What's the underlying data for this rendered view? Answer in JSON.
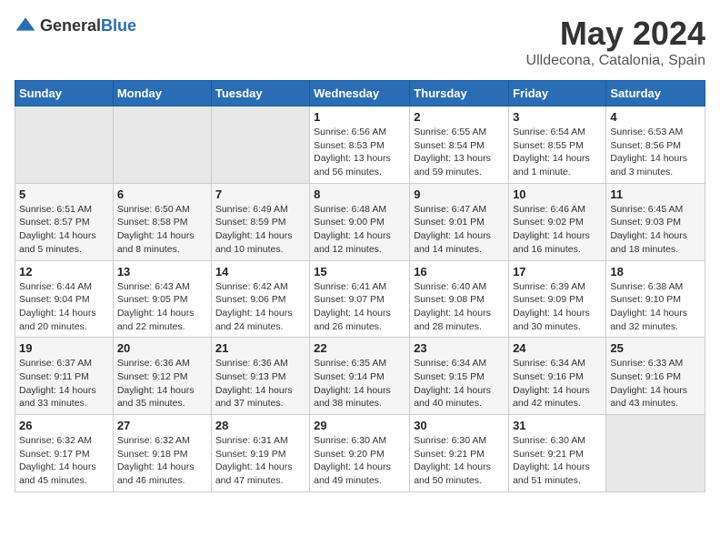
{
  "header": {
    "logo_general": "General",
    "logo_blue": "Blue",
    "month": "May 2024",
    "location": "Ulldecona, Catalonia, Spain"
  },
  "weekdays": [
    "Sunday",
    "Monday",
    "Tuesday",
    "Wednesday",
    "Thursday",
    "Friday",
    "Saturday"
  ],
  "weeks": [
    [
      {
        "day": "",
        "sunrise": "",
        "sunset": "",
        "daylight": "",
        "empty": true
      },
      {
        "day": "",
        "sunrise": "",
        "sunset": "",
        "daylight": "",
        "empty": true
      },
      {
        "day": "",
        "sunrise": "",
        "sunset": "",
        "daylight": "",
        "empty": true
      },
      {
        "day": "1",
        "sunrise": "Sunrise: 6:56 AM",
        "sunset": "Sunset: 8:53 PM",
        "daylight": "Daylight: 13 hours and 56 minutes."
      },
      {
        "day": "2",
        "sunrise": "Sunrise: 6:55 AM",
        "sunset": "Sunset: 8:54 PM",
        "daylight": "Daylight: 13 hours and 59 minutes."
      },
      {
        "day": "3",
        "sunrise": "Sunrise: 6:54 AM",
        "sunset": "Sunset: 8:55 PM",
        "daylight": "Daylight: 14 hours and 1 minute."
      },
      {
        "day": "4",
        "sunrise": "Sunrise: 6:53 AM",
        "sunset": "Sunset: 8:56 PM",
        "daylight": "Daylight: 14 hours and 3 minutes."
      }
    ],
    [
      {
        "day": "5",
        "sunrise": "Sunrise: 6:51 AM",
        "sunset": "Sunset: 8:57 PM",
        "daylight": "Daylight: 14 hours and 5 minutes."
      },
      {
        "day": "6",
        "sunrise": "Sunrise: 6:50 AM",
        "sunset": "Sunset: 8:58 PM",
        "daylight": "Daylight: 14 hours and 8 minutes."
      },
      {
        "day": "7",
        "sunrise": "Sunrise: 6:49 AM",
        "sunset": "Sunset: 8:59 PM",
        "daylight": "Daylight: 14 hours and 10 minutes."
      },
      {
        "day": "8",
        "sunrise": "Sunrise: 6:48 AM",
        "sunset": "Sunset: 9:00 PM",
        "daylight": "Daylight: 14 hours and 12 minutes."
      },
      {
        "day": "9",
        "sunrise": "Sunrise: 6:47 AM",
        "sunset": "Sunset: 9:01 PM",
        "daylight": "Daylight: 14 hours and 14 minutes."
      },
      {
        "day": "10",
        "sunrise": "Sunrise: 6:46 AM",
        "sunset": "Sunset: 9:02 PM",
        "daylight": "Daylight: 14 hours and 16 minutes."
      },
      {
        "day": "11",
        "sunrise": "Sunrise: 6:45 AM",
        "sunset": "Sunset: 9:03 PM",
        "daylight": "Daylight: 14 hours and 18 minutes."
      }
    ],
    [
      {
        "day": "12",
        "sunrise": "Sunrise: 6:44 AM",
        "sunset": "Sunset: 9:04 PM",
        "daylight": "Daylight: 14 hours and 20 minutes."
      },
      {
        "day": "13",
        "sunrise": "Sunrise: 6:43 AM",
        "sunset": "Sunset: 9:05 PM",
        "daylight": "Daylight: 14 hours and 22 minutes."
      },
      {
        "day": "14",
        "sunrise": "Sunrise: 6:42 AM",
        "sunset": "Sunset: 9:06 PM",
        "daylight": "Daylight: 14 hours and 24 minutes."
      },
      {
        "day": "15",
        "sunrise": "Sunrise: 6:41 AM",
        "sunset": "Sunset: 9:07 PM",
        "daylight": "Daylight: 14 hours and 26 minutes."
      },
      {
        "day": "16",
        "sunrise": "Sunrise: 6:40 AM",
        "sunset": "Sunset: 9:08 PM",
        "daylight": "Daylight: 14 hours and 28 minutes."
      },
      {
        "day": "17",
        "sunrise": "Sunrise: 6:39 AM",
        "sunset": "Sunset: 9:09 PM",
        "daylight": "Daylight: 14 hours and 30 minutes."
      },
      {
        "day": "18",
        "sunrise": "Sunrise: 6:38 AM",
        "sunset": "Sunset: 9:10 PM",
        "daylight": "Daylight: 14 hours and 32 minutes."
      }
    ],
    [
      {
        "day": "19",
        "sunrise": "Sunrise: 6:37 AM",
        "sunset": "Sunset: 9:11 PM",
        "daylight": "Daylight: 14 hours and 33 minutes."
      },
      {
        "day": "20",
        "sunrise": "Sunrise: 6:36 AM",
        "sunset": "Sunset: 9:12 PM",
        "daylight": "Daylight: 14 hours and 35 minutes."
      },
      {
        "day": "21",
        "sunrise": "Sunrise: 6:36 AM",
        "sunset": "Sunset: 9:13 PM",
        "daylight": "Daylight: 14 hours and 37 minutes."
      },
      {
        "day": "22",
        "sunrise": "Sunrise: 6:35 AM",
        "sunset": "Sunset: 9:14 PM",
        "daylight": "Daylight: 14 hours and 38 minutes."
      },
      {
        "day": "23",
        "sunrise": "Sunrise: 6:34 AM",
        "sunset": "Sunset: 9:15 PM",
        "daylight": "Daylight: 14 hours and 40 minutes."
      },
      {
        "day": "24",
        "sunrise": "Sunrise: 6:34 AM",
        "sunset": "Sunset: 9:16 PM",
        "daylight": "Daylight: 14 hours and 42 minutes."
      },
      {
        "day": "25",
        "sunrise": "Sunrise: 6:33 AM",
        "sunset": "Sunset: 9:16 PM",
        "daylight": "Daylight: 14 hours and 43 minutes."
      }
    ],
    [
      {
        "day": "26",
        "sunrise": "Sunrise: 6:32 AM",
        "sunset": "Sunset: 9:17 PM",
        "daylight": "Daylight: 14 hours and 45 minutes."
      },
      {
        "day": "27",
        "sunrise": "Sunrise: 6:32 AM",
        "sunset": "Sunset: 9:18 PM",
        "daylight": "Daylight: 14 hours and 46 minutes."
      },
      {
        "day": "28",
        "sunrise": "Sunrise: 6:31 AM",
        "sunset": "Sunset: 9:19 PM",
        "daylight": "Daylight: 14 hours and 47 minutes."
      },
      {
        "day": "29",
        "sunrise": "Sunrise: 6:30 AM",
        "sunset": "Sunset: 9:20 PM",
        "daylight": "Daylight: 14 hours and 49 minutes."
      },
      {
        "day": "30",
        "sunrise": "Sunrise: 6:30 AM",
        "sunset": "Sunset: 9:21 PM",
        "daylight": "Daylight: 14 hours and 50 minutes."
      },
      {
        "day": "31",
        "sunrise": "Sunrise: 6:30 AM",
        "sunset": "Sunset: 9:21 PM",
        "daylight": "Daylight: 14 hours and 51 minutes."
      },
      {
        "day": "",
        "sunrise": "",
        "sunset": "",
        "daylight": "",
        "empty": true
      }
    ]
  ]
}
